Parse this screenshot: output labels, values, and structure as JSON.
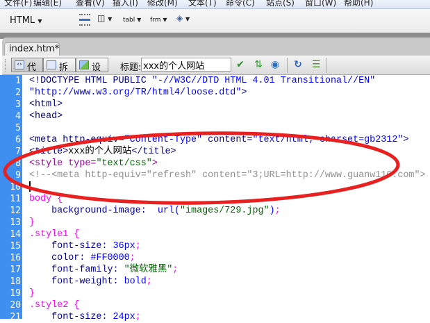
{
  "menu": [
    "文件(F)",
    "编辑(E)",
    "查看(V)",
    "插入(I)",
    "修改(M)",
    "文本(T)",
    "命令(C)",
    "站点(S)",
    "窗口(W)",
    "帮助(H)"
  ],
  "toolbar": {
    "category": "HTML",
    "tabl": "tabl",
    "frm": "frm"
  },
  "tab": {
    "filename": "index.htm*"
  },
  "doc_toolbar": {
    "code": "代码",
    "split": "拆分",
    "design": "设计",
    "title_label": "标题:",
    "title_value": "xxx的个人网站"
  },
  "annotation_color": "#e82020",
  "code_lines": [
    [
      [
        "<!DOCTYPE HTML PUBLIC ",
        "tag"
      ],
      [
        "\"-//W3C//DTD HTML 4.01 Transitional//EN\"",
        "val"
      ]
    ],
    [
      [
        "\"http://www.w3.org/TR/html4/loose.dtd\"",
        "val"
      ],
      [
        ">",
        "tag"
      ]
    ],
    [
      [
        "<html>",
        "tag"
      ]
    ],
    [
      [
        "<head>",
        "tag"
      ]
    ],
    [],
    [
      [
        "<meta http-equiv=",
        "tag"
      ],
      [
        "\"Content-Type\"",
        "val"
      ],
      [
        " content=",
        "tag"
      ],
      [
        "\"text/html; charset=gb2312\"",
        "val"
      ],
      [
        ">",
        "tag"
      ]
    ],
    [
      [
        "<title>",
        "tag"
      ],
      [
        "xxx的个人网站",
        "txt"
      ],
      [
        "</title>",
        "tag"
      ]
    ],
    [
      [
        "<style type=",
        "sty"
      ],
      [
        "\"text/css\"",
        "str"
      ],
      [
        ">",
        "sty"
      ]
    ],
    [
      [
        "<!--<meta http-equiv=\"refresh\" content=\"3;URL=http://www.guanw110.com\">",
        "cmt"
      ]
    ],
    [],
    [
      [
        "body {",
        "sel"
      ]
    ],
    [
      [
        "    background-image: ",
        "prop"
      ],
      [
        " url(",
        "num"
      ],
      [
        "\"images/729.jpg\"",
        "str"
      ],
      [
        ")",
        "num"
      ],
      [
        ";",
        "pun"
      ]
    ],
    [
      [
        "}",
        "sel"
      ]
    ],
    [
      [
        ".style1 {",
        "sel"
      ]
    ],
    [
      [
        "    font-size: ",
        "prop"
      ],
      [
        "36px",
        "num"
      ],
      [
        ";",
        "pun"
      ]
    ],
    [
      [
        "    color: ",
        "prop"
      ],
      [
        "#FF0000",
        "num"
      ],
      [
        ";",
        "pun"
      ]
    ],
    [
      [
        "    font-family: ",
        "prop"
      ],
      [
        "\"微软雅黑\"",
        "str"
      ],
      [
        ";",
        "pun"
      ]
    ],
    [
      [
        "    font-weight: ",
        "prop"
      ],
      [
        "bold",
        "num"
      ],
      [
        ";",
        "pun"
      ]
    ],
    [
      [
        "}",
        "sel"
      ]
    ],
    [
      [
        ".style2 {",
        "sel"
      ]
    ],
    [
      [
        "    font-size: ",
        "prop"
      ],
      [
        "24px",
        "num"
      ],
      [
        ";",
        "pun"
      ]
    ]
  ]
}
